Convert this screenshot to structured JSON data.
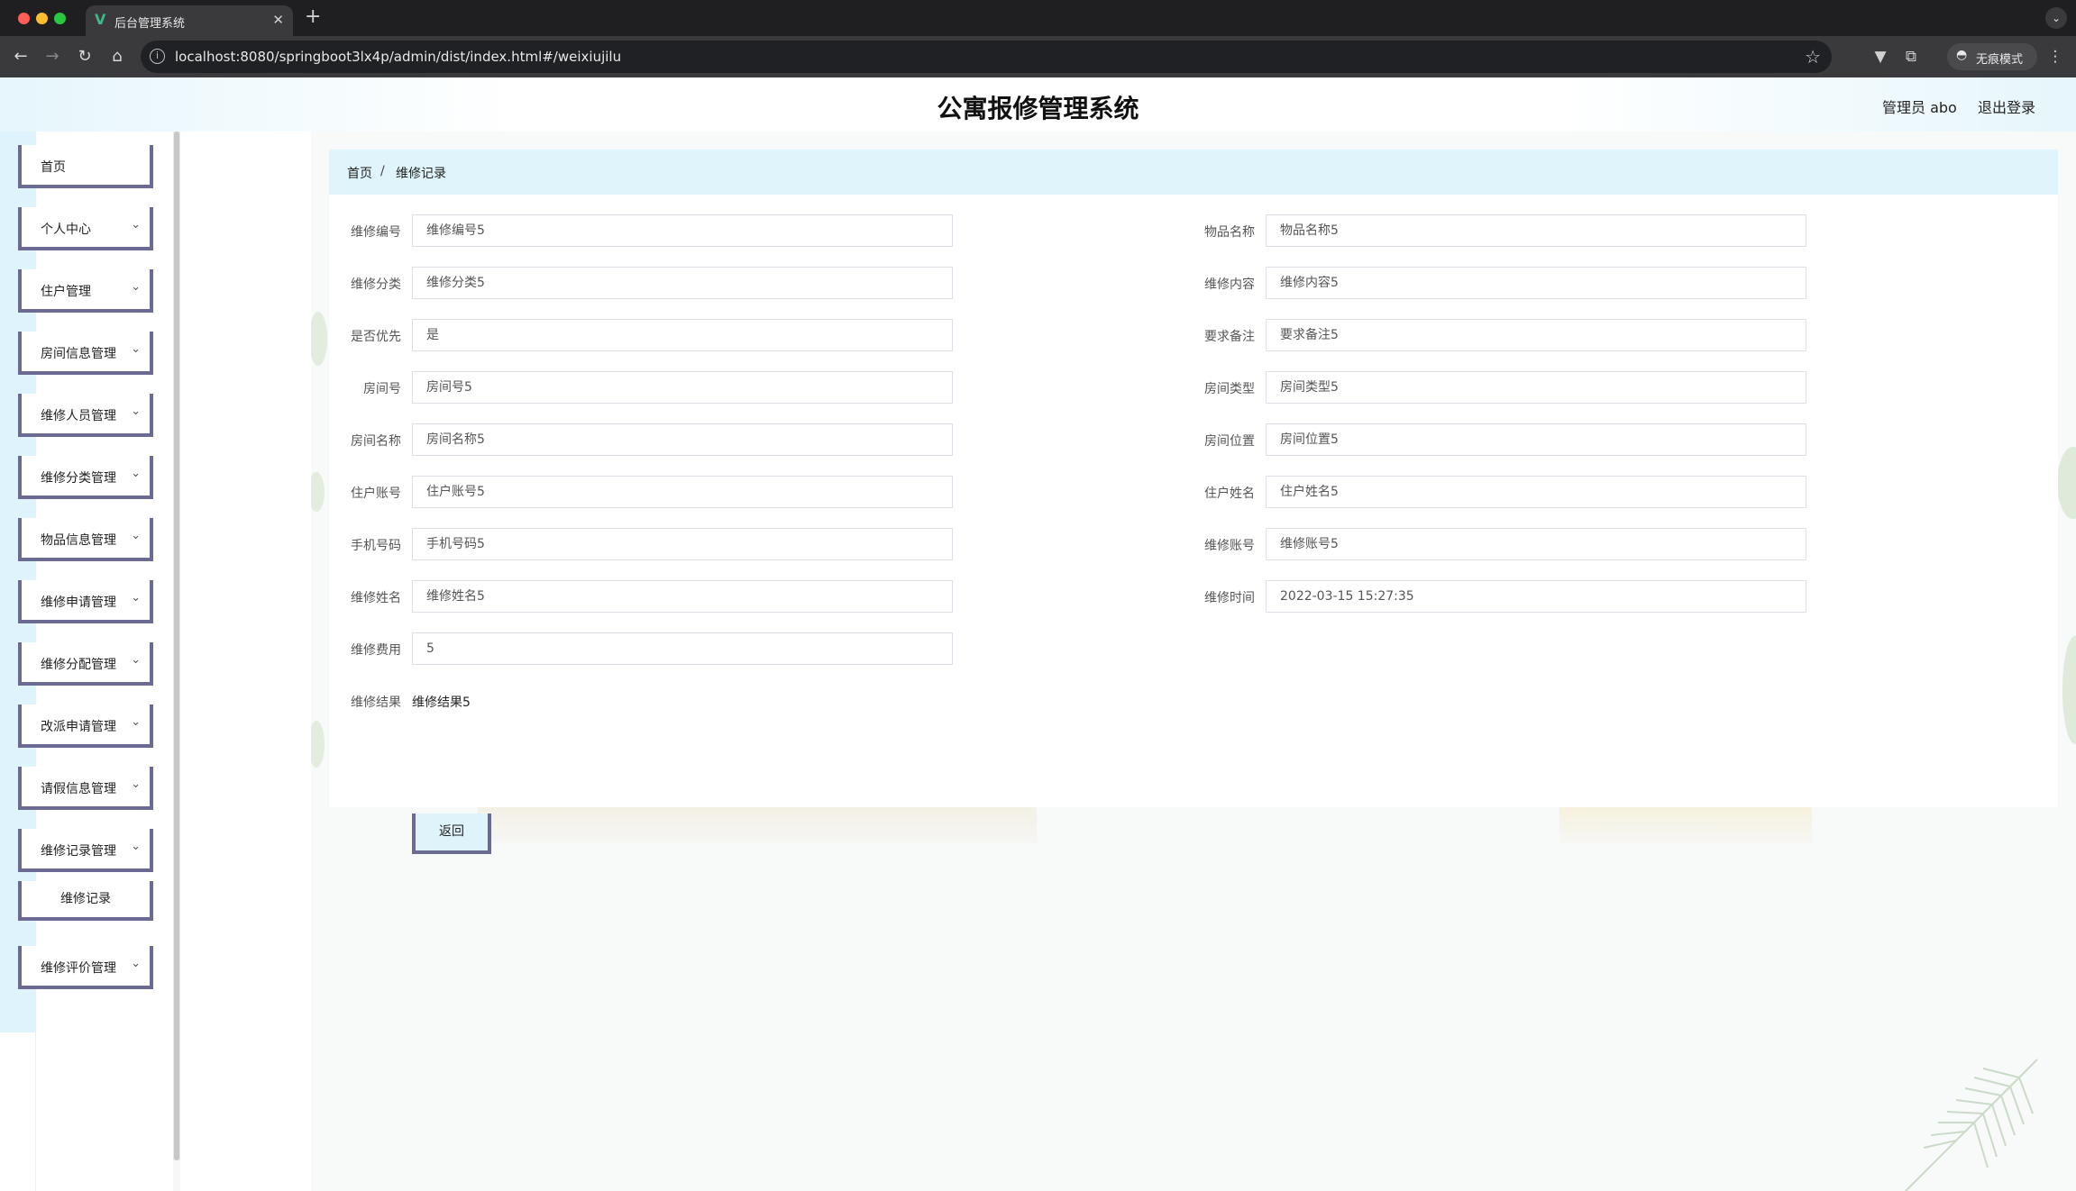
{
  "browser": {
    "tab_title": "后台管理系统",
    "tab_favicon": "V",
    "url": "localhost:8080/springboot3lx4p/admin/dist/index.html#/weixiujilu",
    "incognito_label": "无痕模式",
    "icons": {
      "back": "back-arrow-icon",
      "forward": "forward-arrow-icon",
      "reload": "reload-icon",
      "home": "home-icon",
      "info": "site-info-icon",
      "bookmark": "star-icon",
      "extension": "puzzle-icon",
      "menu": "kebab-menu-icon"
    }
  },
  "header": {
    "title": "公寓报修管理系统",
    "user": "管理员 abo",
    "logout": "退出登录"
  },
  "sidebar": {
    "items": [
      {
        "label": "首页",
        "has_caret": false
      },
      {
        "label": "个人中心",
        "has_caret": true
      },
      {
        "label": "住户管理",
        "has_caret": true
      },
      {
        "label": "房间信息管理",
        "has_caret": true
      },
      {
        "label": "维修人员管理",
        "has_caret": true
      },
      {
        "label": "维修分类管理",
        "has_caret": true
      },
      {
        "label": "物品信息管理",
        "has_caret": true
      },
      {
        "label": "维修申请管理",
        "has_caret": true
      },
      {
        "label": "维修分配管理",
        "has_caret": true
      },
      {
        "label": "改派申请管理",
        "has_caret": true
      },
      {
        "label": "请假信息管理",
        "has_caret": true
      },
      {
        "label": "维修记录管理",
        "has_caret": true
      },
      {
        "label": "维修评价管理",
        "has_caret": true
      }
    ],
    "submenu": {
      "label": "维修记录"
    }
  },
  "breadcrumb": {
    "home": "首页",
    "separator": "/",
    "current": "维修记录"
  },
  "form": {
    "left": [
      {
        "label": "维修编号",
        "value": "维修编号5"
      },
      {
        "label": "维修分类",
        "value": "维修分类5"
      },
      {
        "label": "是否优先",
        "value": "是"
      },
      {
        "label": "房间号",
        "value": "房间号5"
      },
      {
        "label": "房间名称",
        "value": "房间名称5"
      },
      {
        "label": "住户账号",
        "value": "住户账号5"
      },
      {
        "label": "手机号码",
        "value": "手机号码5"
      },
      {
        "label": "维修姓名",
        "value": "维修姓名5"
      },
      {
        "label": "维修费用",
        "value": "5"
      }
    ],
    "right": [
      {
        "label": "物品名称",
        "value": "物品名称5"
      },
      {
        "label": "维修内容",
        "value": "维修内容5"
      },
      {
        "label": "要求备注",
        "value": "要求备注5"
      },
      {
        "label": "房间类型",
        "value": "房间类型5"
      },
      {
        "label": "房间位置",
        "value": "房间位置5"
      },
      {
        "label": "住户姓名",
        "value": "住户姓名5"
      },
      {
        "label": "维修账号",
        "value": "维修账号5"
      },
      {
        "label": "维修时间",
        "value": "2022-03-15 15:27:35"
      }
    ],
    "result": {
      "label": "维修结果",
      "value": "维修结果5"
    },
    "back_button": "返回"
  },
  "colors": {
    "accent_border": "#6a6a93",
    "breadcrumb_bg": "#dff4fb",
    "sidebar_strip": "#dff3fc"
  }
}
